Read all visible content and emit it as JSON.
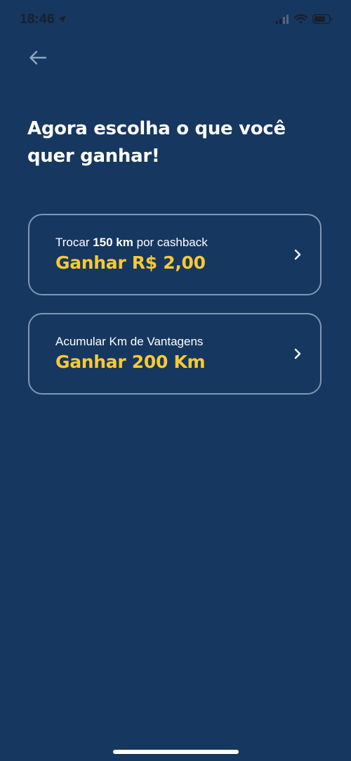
{
  "status_bar": {
    "time": "18:46",
    "location_icon": "location-arrow-icon",
    "signal_icon": "cellular-signal-icon",
    "wifi_icon": "wifi-icon",
    "battery_icon": "battery-icon"
  },
  "nav": {
    "back_icon": "arrow-left-icon"
  },
  "title": "Agora escolha o que você quer ganhar!",
  "options": [
    {
      "label_prefix": "Trocar ",
      "label_bold": "150 km",
      "label_suffix": " por cashback",
      "value": "Ganhar R$ 2,00",
      "icon": "chevron-right-icon"
    },
    {
      "label_prefix": "Acumular Km de Vantagens",
      "label_bold": "",
      "label_suffix": "",
      "value": "Ganhar 200 Km",
      "icon": "chevron-right-icon"
    }
  ],
  "colors": {
    "background": "#163760",
    "card_border": "#7f97b5",
    "accent_yellow": "#f7c934",
    "text_white": "#ffffff",
    "back_arrow": "#8fa5c0"
  }
}
